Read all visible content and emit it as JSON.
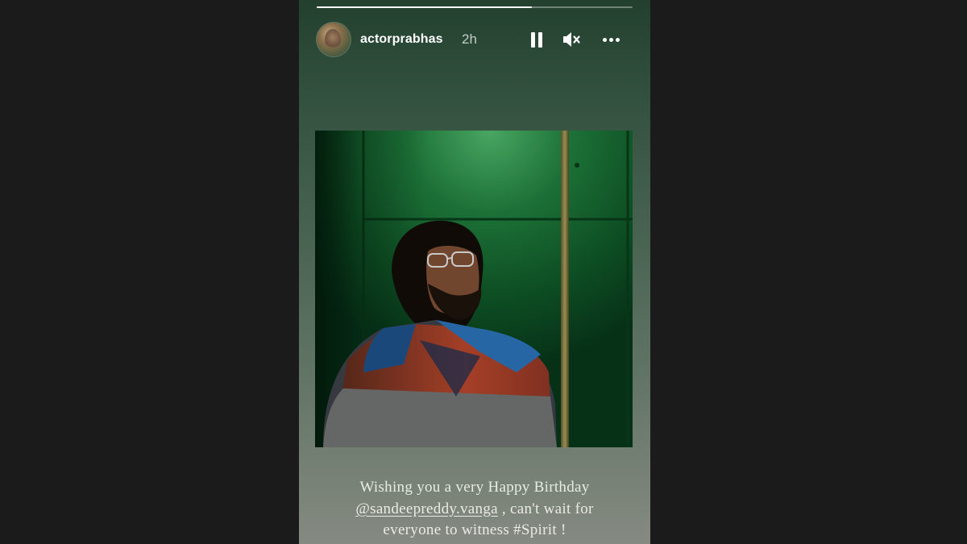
{
  "story": {
    "progress": 0.68,
    "username": "actorprabhas",
    "time": "2h",
    "icons": {
      "avatar": "profile-avatar",
      "pause": "pause-icon",
      "mute": "muted-speaker-icon",
      "more": "more-options-icon"
    },
    "caption": {
      "line1": "Wishing you a very Happy Birthday",
      "mention": "@sandeepreddy.vanga",
      "line2_rest": " , can't wait for",
      "line3": "everyone to witness #Spirit !"
    }
  },
  "colors": {
    "page_background": "#1b1b1b",
    "wall_green": "#145c2a"
  }
}
